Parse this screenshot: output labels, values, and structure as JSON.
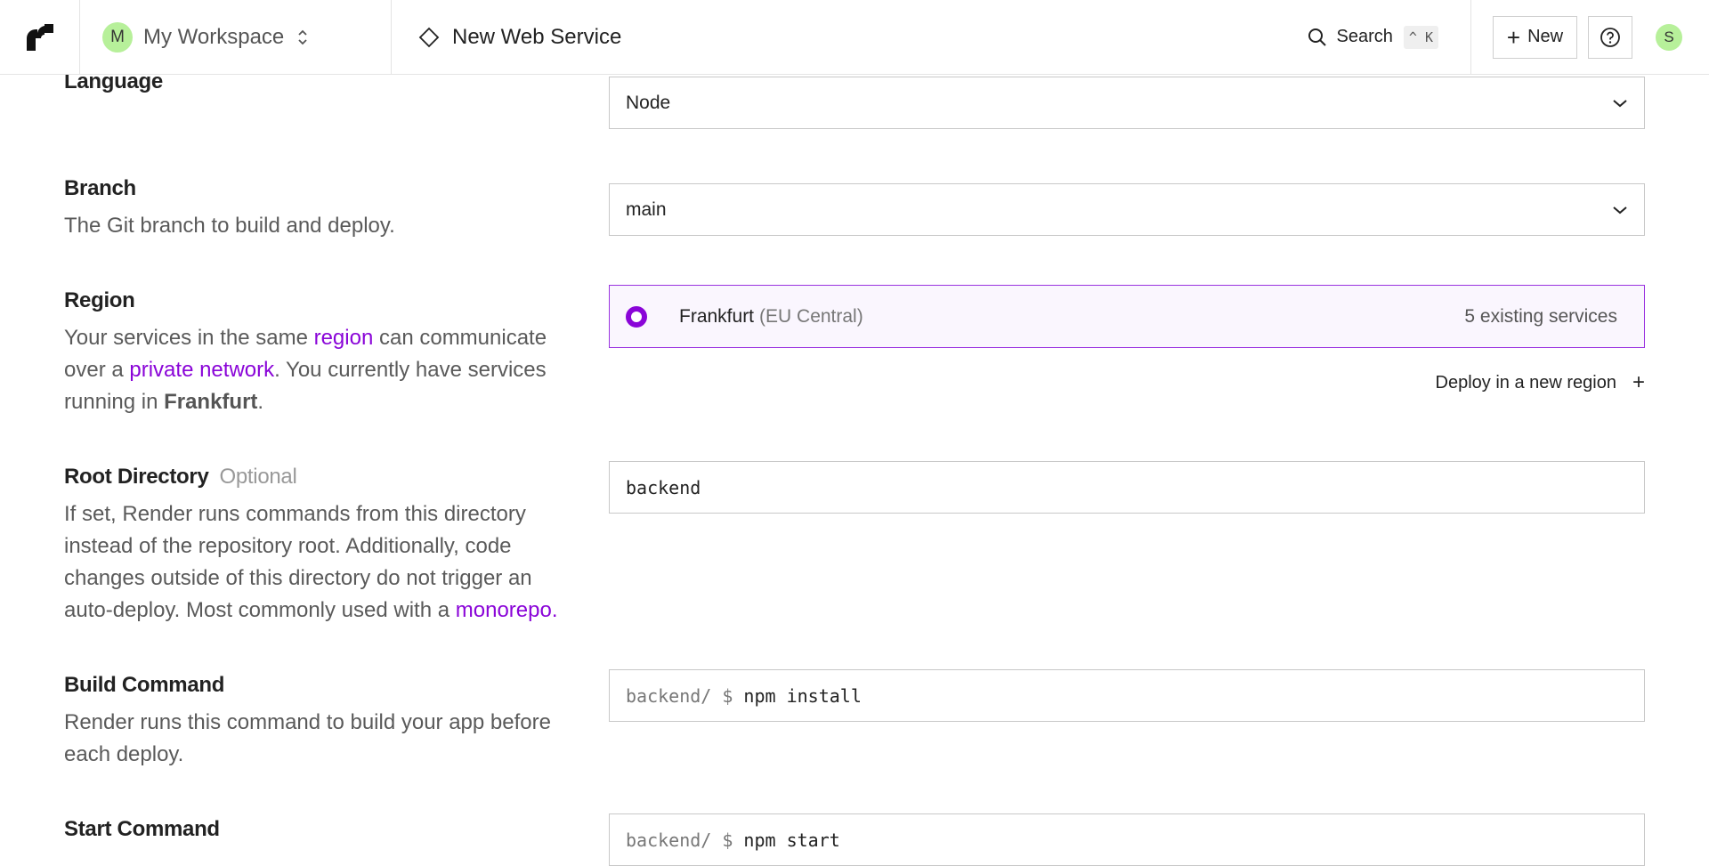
{
  "header": {
    "workspace": {
      "avatar_letter": "M",
      "name": "My Workspace"
    },
    "service_title": "New Web Service",
    "search": {
      "label": "Search",
      "shortcut": "^ K"
    },
    "new_button": "New",
    "user_avatar": "S",
    "icons": [
      "render-logo-icon",
      "chevron-updown-icon",
      "diamond-icon",
      "search-icon",
      "plus-icon",
      "help-icon"
    ]
  },
  "form": {
    "language": {
      "label": "Language",
      "value": "Node"
    },
    "branch": {
      "label": "Branch",
      "description": "The Git branch to build and deploy.",
      "value": "main"
    },
    "region": {
      "label": "Region",
      "desc_part1": "Your services in the same ",
      "desc_link1": "region",
      "desc_part2": " can communicate over a ",
      "desc_link2": "private network",
      "desc_part3": ". You currently have services running in ",
      "desc_strong": "Frankfurt",
      "desc_part4": ".",
      "option": {
        "name": "Frankfurt",
        "sublabel": "(EU Central)",
        "count": "5 existing services",
        "selected": true
      },
      "deploy_new": "Deploy in a new region"
    },
    "root_directory": {
      "label": "Root Directory",
      "optional": "Optional",
      "desc_part1": "If set, Render runs commands from this directory instead of the repository root. Additionally, code changes outside of this directory do not trigger an auto-deploy. Most commonly used with a ",
      "desc_link": "monorepo",
      "desc_part2": ".",
      "value": "backend"
    },
    "build_command": {
      "label": "Build Command",
      "description": "Render runs this command to build your app before each deploy.",
      "prefix": "backend/ $",
      "value": "npm install"
    },
    "start_command": {
      "label": "Start Command",
      "prefix": "backend/ $",
      "value": "npm start"
    }
  },
  "colors": {
    "accent": "#8a05d8",
    "avatar_green": "#b7f09a",
    "selected_border": "#9a33e0"
  }
}
